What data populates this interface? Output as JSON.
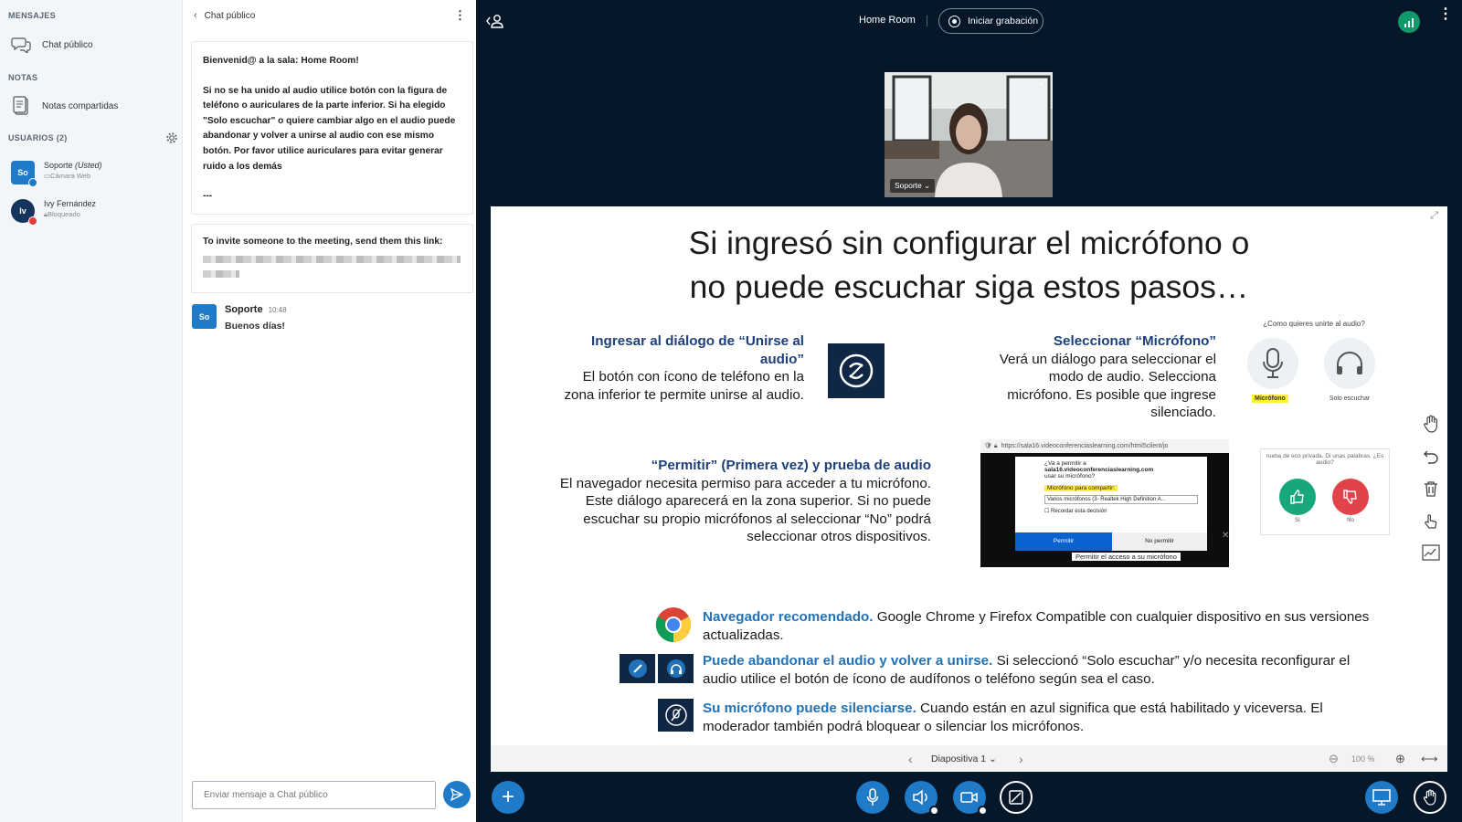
{
  "sidebar": {
    "messages_header": "MENSAJES",
    "public_chat": "Chat público",
    "notes_header": "NOTAS",
    "shared_notes": "Notas compartidas",
    "users_header": "USUARIOS (2)",
    "users": [
      {
        "initials": "So",
        "name": "Soporte",
        "tag": "(Usted)",
        "sub": "Cámara Web",
        "color": "#1f7ac8"
      },
      {
        "initials": "Iv",
        "name": "Ivy Fernández",
        "sub": "Bloqueado",
        "color": "#15345c"
      }
    ]
  },
  "chat": {
    "title": "Chat público",
    "welcome_line1": "Bienvenid@ a la sala: Home Room!",
    "welcome_line2": "Si no se ha unido al audio utilice botón con la figura de teléfono o auriculares de la parte inferior. Si ha elegido \"Solo escuchar\" o quiere cambiar algo en el audio puede abandonar y volver a unirse al audio con ese mismo botón. Por favor utilice auriculares para evitar generar ruido a los demás",
    "welcome_line3": "---",
    "invite_text": "To invite someone to the meeting, send them this link:",
    "message": {
      "initials": "So",
      "author": "Soporte",
      "time": "10:48",
      "text": "Buenos días!"
    },
    "input_placeholder": "Enviar mensaje a Chat público"
  },
  "topbar": {
    "room_name": "Home Room",
    "record_label": "Iniciar grabación"
  },
  "webcam": {
    "label": "Soporte"
  },
  "slide": {
    "title_line1": "Si ingresó sin configurar el micrófono o",
    "title_line2": "no puede escuchar siga estos pasos…",
    "step1_heading": "Ingresar al diálogo de “Unirse al audio”",
    "step1_body": "El botón con ícono de teléfono en la zona inferior te permite unirse al audio.",
    "step2_heading": "Seleccionar “Micrófono”",
    "step2_body": "Verá un diálogo para seleccionar el modo de audio. Selecciona micrófono. Es posible que ingrese silenciado.",
    "step3_heading": "“Permitir” (Primera vez) y prueba de audio",
    "step3_body": "El navegador necesita permiso para acceder a tu micrófono. Este diálogo aparecerá en la zona superior. Si no puede escuchar su propio micrófonos al seleccionar “No” podrá seleccionar otros dispositivos.",
    "join_prompt": "¿Como quieres unirte al audio?",
    "mic_option": "Micrófono",
    "listen_option": "Solo escuchar",
    "browser_url": "https://sala16.videoconferenciaslearning.com/html5client/jo",
    "perm_q": "¿Va a permitir a",
    "perm_host": "sala16.videoconferenciaslearning.com",
    "perm_q2": "usar su micrófono?",
    "perm_share": "Micrófono para compartir:",
    "perm_device": "Varios micrófonos (3- Realtek High Definition A...",
    "perm_remember": "Recordar esta decisión",
    "perm_allow": "Permitir",
    "perm_deny": "No permitir",
    "perm_footer": "Permitir el acceso a su micrófono",
    "echo_text": "rueba de eco privada. Di unas palabras. ¿Es audio?",
    "echo_yes": "Sí",
    "echo_no": "No",
    "b1_heading": "Navegador recomendado.",
    "b1_body": "Google Chrome y Firefox Compatible con cualquier dispositivo en sus versiones actualizadas.",
    "b2_heading": "Puede abandonar el audio y volver a unirse.",
    "b2_body": "Si seleccionó “Solo escuchar” y/o necesita reconfigurar el audio utilice el botón de ícono de audífonos o teléfono según sea el caso.",
    "b3_heading": "Su micrófono puede silenciarse.",
    "b3_body": "Cuando están en azul significa que está habilitado y viceversa. El moderador también podrá bloquear o silenciar los micrófonos."
  },
  "presentation": {
    "slide_label": "Diapositiva 1",
    "zoom": "100 %"
  },
  "colors": {
    "navy": "#06172a",
    "accent": "#1f7ac8",
    "slide_heading": "#1f3f79",
    "slide_link": "#2172b8"
  }
}
